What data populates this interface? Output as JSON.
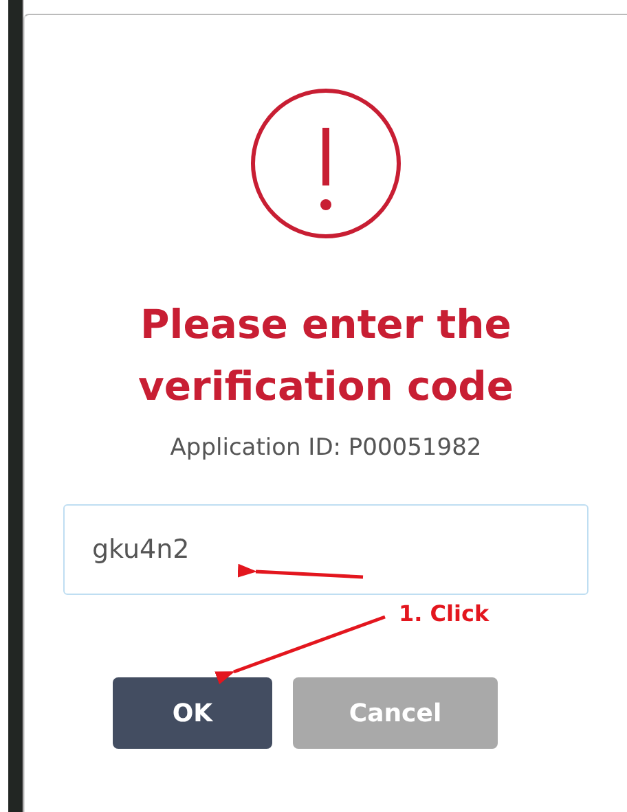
{
  "dialog": {
    "title": "Please enter the verification code",
    "subtitle": "Application ID: P00051982",
    "code_field": {
      "value": "gku4n2"
    },
    "buttons": [
      {
        "label": "OK",
        "kind": "primary"
      },
      {
        "label": "Cancel",
        "kind": "secondary"
      }
    ]
  },
  "annotation": {
    "label": "1. Click"
  }
}
